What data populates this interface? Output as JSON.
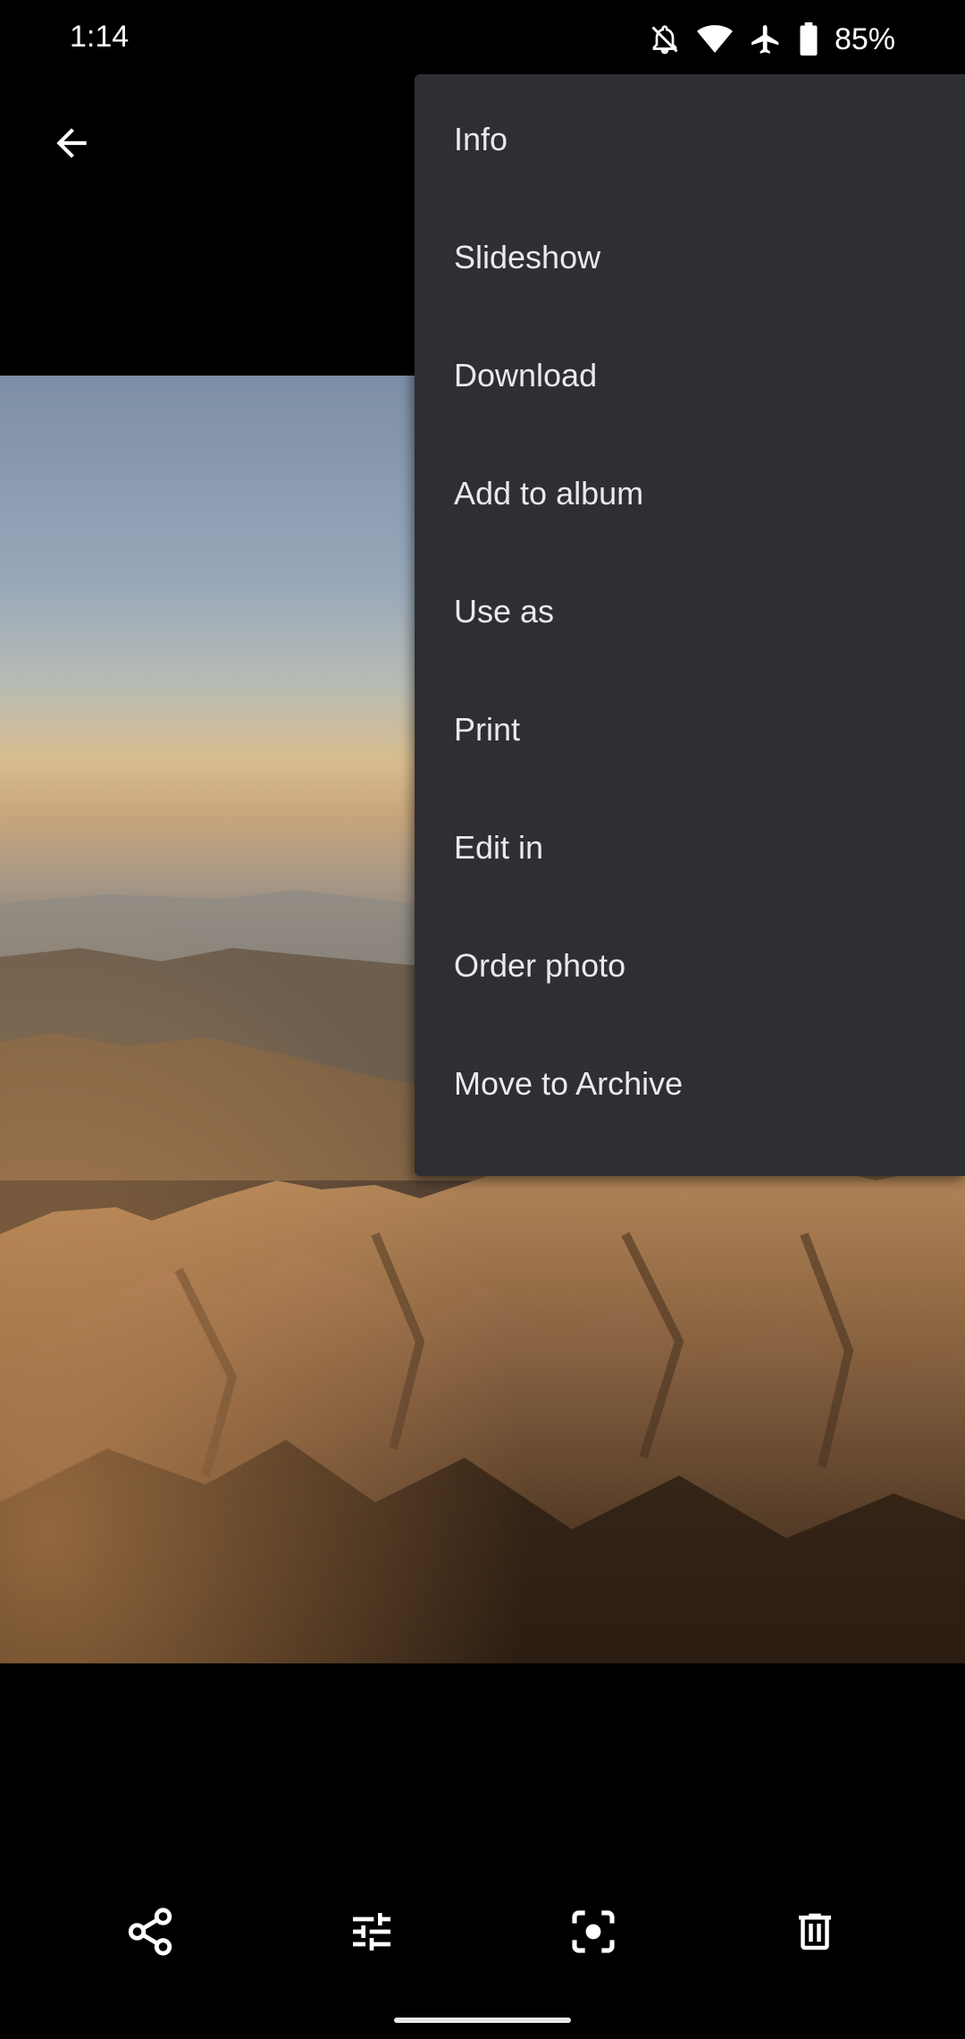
{
  "status_bar": {
    "time": "1:14",
    "battery_percent": "85%",
    "icons": [
      "notifications-off-icon",
      "wifi-icon",
      "airplane-mode-icon",
      "battery-icon"
    ]
  },
  "toolbar": {
    "back_icon": "arrow-back-icon"
  },
  "menu": {
    "items": [
      {
        "label": "Info"
      },
      {
        "label": "Slideshow"
      },
      {
        "label": "Download"
      },
      {
        "label": "Add to album"
      },
      {
        "label": "Use as"
      },
      {
        "label": "Print"
      },
      {
        "label": "Edit in"
      },
      {
        "label": "Order photo"
      },
      {
        "label": "Move to Archive"
      }
    ],
    "background": "#2e2f32"
  },
  "bottom_actions": {
    "icons": [
      "share-icon",
      "edit-adjust-icon",
      "lens-icon",
      "delete-icon"
    ]
  }
}
